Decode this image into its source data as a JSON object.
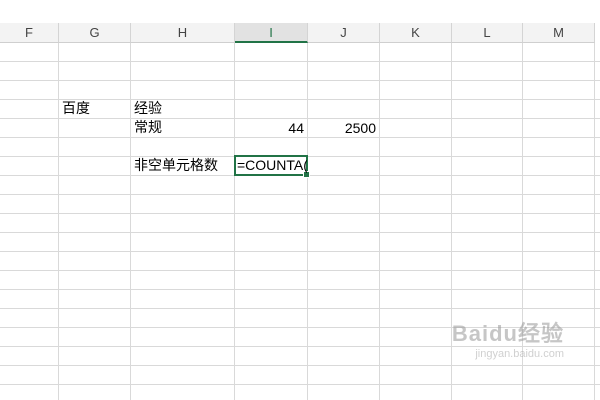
{
  "sheet": {
    "columns": [
      "F",
      "G",
      "H",
      "I",
      "J",
      "K",
      "L",
      "M"
    ],
    "active_column": "I",
    "cells": {
      "g_row4": "百度",
      "h_row4": "经验",
      "h_row5": "常规",
      "i_row5": "44",
      "j_row5": "2500",
      "h_row7": "非空单元格数"
    },
    "active_cell_value": "=COUNTA("
  },
  "watermark": {
    "brand": "Baidu经验",
    "url": "jingyan.baidu.com"
  }
}
